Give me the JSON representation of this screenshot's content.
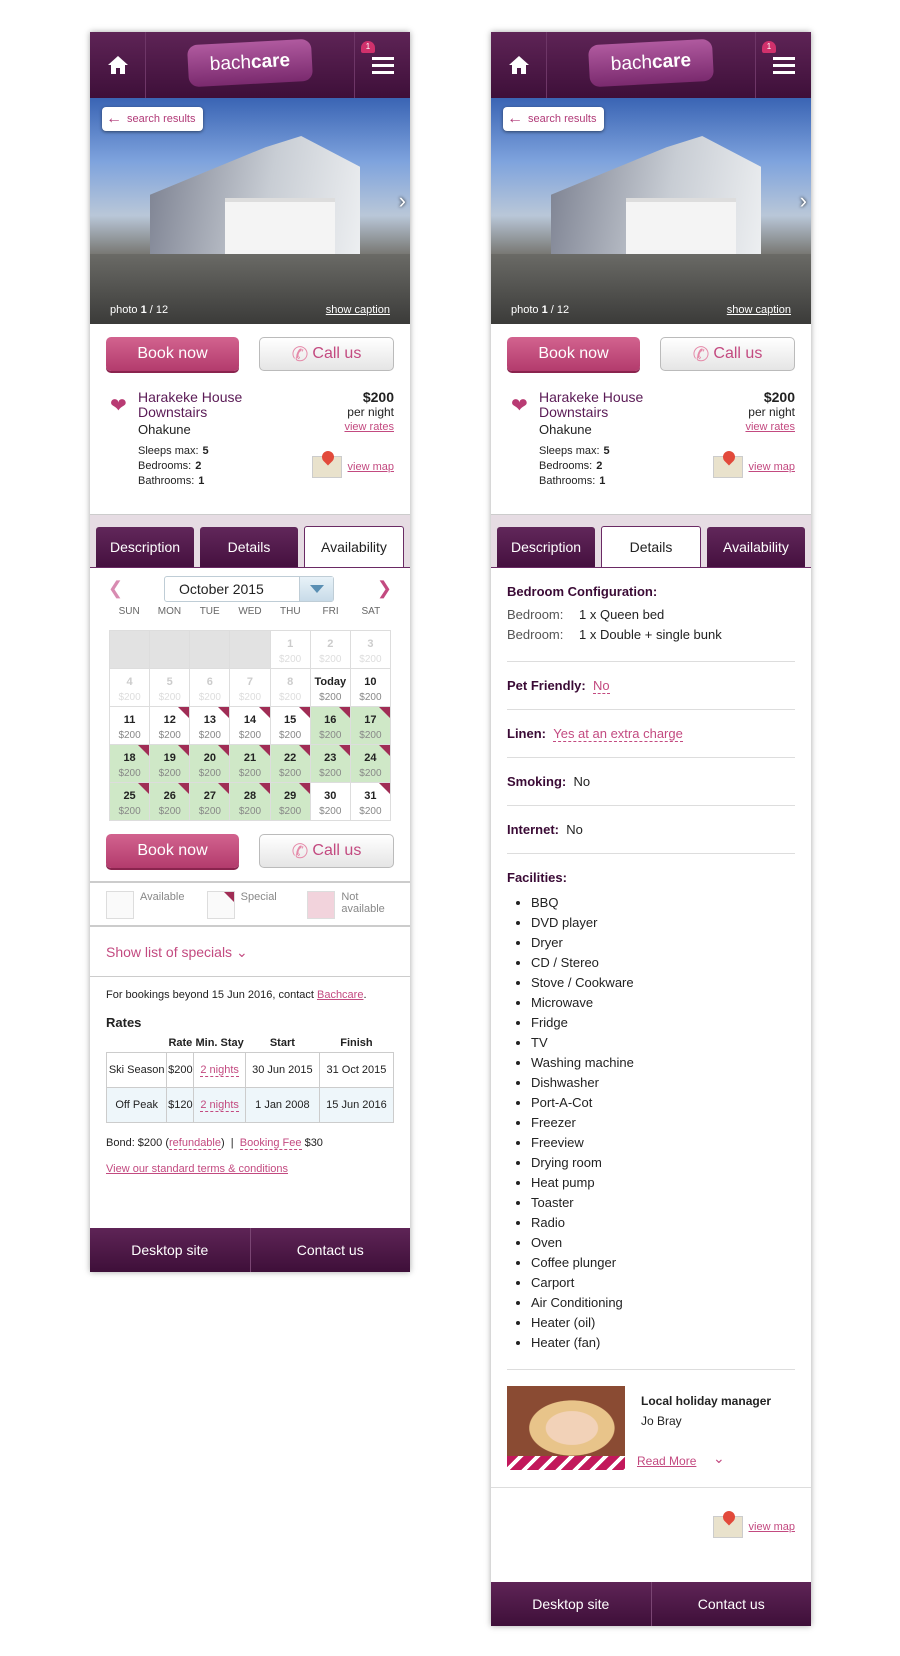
{
  "header": {
    "logo_light": "bach",
    "logo_bold": "care",
    "fav_count": "1"
  },
  "photo": {
    "back_label": "search results",
    "photo_label": "photo",
    "photo_current": "1",
    "photo_total": "/ 12",
    "caption_link": "show caption"
  },
  "actions": {
    "book": "Book now",
    "call": "Call us"
  },
  "property": {
    "name": "Harakeke House Downstairs",
    "location": "Ohakune",
    "price": "$200",
    "per": "per night",
    "rates_link": "view rates",
    "sleeps_label": "Sleeps max:",
    "sleeps": "5",
    "bedrooms_label": "Bedrooms:",
    "bedrooms": "2",
    "bathrooms_label": "Bathrooms:",
    "bathrooms": "1",
    "map_link": "view map"
  },
  "tabs": [
    "Description",
    "Details",
    "Availability"
  ],
  "calendar": {
    "month": "October 2015",
    "dows": [
      "SUN",
      "MON",
      "TUE",
      "WED",
      "THU",
      "FRI",
      "SAT"
    ],
    "weeks": [
      [
        {
          "d": "",
          "p": "",
          "s": "blank"
        },
        {
          "d": "",
          "p": "",
          "s": "blank"
        },
        {
          "d": "",
          "p": "",
          "s": "blank"
        },
        {
          "d": "",
          "p": "",
          "s": "blank"
        },
        {
          "d": "1",
          "p": "$200",
          "s": "past"
        },
        {
          "d": "2",
          "p": "$200",
          "s": "past"
        },
        {
          "d": "3",
          "p": "$200",
          "s": "past"
        }
      ],
      [
        {
          "d": "4",
          "p": "$200",
          "s": "past"
        },
        {
          "d": "5",
          "p": "$200",
          "s": "past"
        },
        {
          "d": "6",
          "p": "$200",
          "s": "past"
        },
        {
          "d": "7",
          "p": "$200",
          "s": "past"
        },
        {
          "d": "8",
          "p": "$200",
          "s": "past"
        },
        {
          "d": "Today",
          "p": "$200",
          "s": "avail"
        },
        {
          "d": "10",
          "p": "$200",
          "s": "avail"
        }
      ],
      [
        {
          "d": "11",
          "p": "$200",
          "s": "avail"
        },
        {
          "d": "12",
          "p": "$200",
          "s": "avail special"
        },
        {
          "d": "13",
          "p": "$200",
          "s": "avail special"
        },
        {
          "d": "14",
          "p": "$200",
          "s": "avail special"
        },
        {
          "d": "15",
          "p": "$200",
          "s": "avail special"
        },
        {
          "d": "16",
          "p": "$200",
          "s": "green special"
        },
        {
          "d": "17",
          "p": "$200",
          "s": "green special"
        }
      ],
      [
        {
          "d": "18",
          "p": "$200",
          "s": "green special"
        },
        {
          "d": "19",
          "p": "$200",
          "s": "green special"
        },
        {
          "d": "20",
          "p": "$200",
          "s": "green special"
        },
        {
          "d": "21",
          "p": "$200",
          "s": "green special"
        },
        {
          "d": "22",
          "p": "$200",
          "s": "green special"
        },
        {
          "d": "23",
          "p": "$200",
          "s": "green special"
        },
        {
          "d": "24",
          "p": "$200",
          "s": "green special"
        }
      ],
      [
        {
          "d": "25",
          "p": "$200",
          "s": "green special"
        },
        {
          "d": "26",
          "p": "$200",
          "s": "green special"
        },
        {
          "d": "27",
          "p": "$200",
          "s": "green special"
        },
        {
          "d": "28",
          "p": "$200",
          "s": "green special"
        },
        {
          "d": "29",
          "p": "$200",
          "s": "green special"
        },
        {
          "d": "30",
          "p": "$200",
          "s": "avail"
        },
        {
          "d": "31",
          "p": "$200",
          "s": "avail special"
        }
      ]
    ]
  },
  "legend": {
    "available": "Available",
    "special": "Special",
    "not_available": "Not available"
  },
  "specials_link": "Show list of specials",
  "beyond": {
    "text": "For bookings beyond 15 Jun 2016, contact ",
    "link": "Bachcare",
    "end": "."
  },
  "rates": {
    "title": "Rates",
    "headers": [
      "",
      "Rate",
      "Min. Stay",
      "Start",
      "Finish"
    ],
    "rows": [
      [
        "Ski Season",
        "$200",
        "2 nights",
        "30 Jun 2015",
        "31 Oct 2015"
      ],
      [
        "Off Peak",
        "$120",
        "2 nights",
        "1 Jan 2008",
        "15 Jun 2016"
      ]
    ]
  },
  "bond": {
    "text": "Bond: $200 (",
    "refundable": "refundable",
    "close": ")  |  ",
    "fee_link": "Booking Fee",
    "fee": " $30"
  },
  "terms_link": "View our standard terms & conditions",
  "footer": {
    "desktop": "Desktop site",
    "contact": "Contact us"
  },
  "details": {
    "bedroom_title": "Bedroom Configuration:",
    "bedrooms": [
      {
        "label": "Bedroom:",
        "value": "1 x Queen bed"
      },
      {
        "label": "Bedroom:",
        "value": "1 x Double + single bunk"
      }
    ],
    "pet_label": "Pet Friendly:",
    "pet": "No",
    "linen_label": "Linen:",
    "linen": "Yes at an extra charge",
    "smoking_label": "Smoking:",
    "smoking": "No",
    "internet_label": "Internet:",
    "internet": "No",
    "facilities_label": "Facilities:",
    "facilities": [
      "BBQ",
      "DVD player",
      "Dryer",
      "CD / Stereo",
      "Stove / Cookware",
      "Microwave",
      "Fridge",
      "TV",
      "Washing machine",
      "Dishwasher",
      "Port-A-Cot",
      "Freezer",
      "Freeview",
      "Drying room",
      "Heat pump",
      "Toaster",
      "Radio",
      "Oven",
      "Coffee plunger",
      "Carport",
      "Air Conditioning",
      "Heater (oil)",
      "Heater (fan)"
    ],
    "manager_title": "Local holiday manager",
    "manager_name": "Jo Bray",
    "read_more": "Read More"
  },
  "colors": {
    "brand": "#4e1648",
    "accent": "#c34a80"
  }
}
